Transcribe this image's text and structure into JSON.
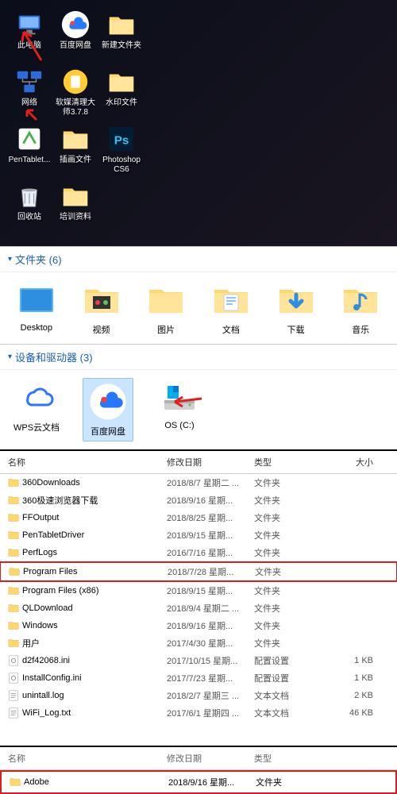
{
  "desktop_rows": [
    [
      {
        "name": "thispc",
        "label": "此电脑",
        "type": "pc"
      },
      {
        "name": "baidu",
        "label": "百度网盘",
        "type": "baidu"
      },
      {
        "name": "newfolder",
        "label": "新建文件夹",
        "type": "folder"
      }
    ],
    [
      {
        "name": "network",
        "label": "网络",
        "type": "network"
      },
      {
        "name": "ruanmei",
        "label": "软媒清理大师3.7.8",
        "type": "app1"
      },
      {
        "name": "watermark",
        "label": "水印文件",
        "type": "folder"
      }
    ],
    [
      {
        "name": "pentablet",
        "label": "PenTablet...",
        "type": "app2"
      },
      {
        "name": "illust",
        "label": "插画文件",
        "type": "folder"
      },
      {
        "name": "ps",
        "label": "Photoshop CS6",
        "type": "ps"
      }
    ],
    [
      {
        "name": "recycle",
        "label": "回收站",
        "type": "recycle"
      },
      {
        "name": "training",
        "label": "培训资料",
        "type": "folder"
      }
    ]
  ],
  "folder_section": {
    "title": "文件夹 (6)"
  },
  "folders": [
    {
      "name": "desktop",
      "label": "Desktop",
      "type": "desktop-folder"
    },
    {
      "name": "video",
      "label": "视频",
      "type": "video"
    },
    {
      "name": "pictures",
      "label": "图片",
      "type": "pictures"
    },
    {
      "name": "docs",
      "label": "文档",
      "type": "docs"
    },
    {
      "name": "download",
      "label": "下载",
      "type": "download"
    },
    {
      "name": "music",
      "label": "音乐",
      "type": "music"
    }
  ],
  "device_section": {
    "title": "设备和驱动器 (3)"
  },
  "devices": [
    {
      "name": "wps",
      "label": "WPS云文档",
      "type": "wps"
    },
    {
      "name": "baidu2",
      "label": "百度网盘",
      "type": "baidu",
      "selected": true
    },
    {
      "name": "osc",
      "label": "OS (C:)",
      "type": "drive"
    }
  ],
  "columns": {
    "c1": "名称",
    "c2": "修改日期",
    "c3": "类型",
    "c4": "大小"
  },
  "files": [
    {
      "name": "360Downloads",
      "date": "2018/8/7 星期二 ...",
      "type": "文件夹",
      "size": "",
      "icon": "folder"
    },
    {
      "name": "360极速浏览器下载",
      "date": "2018/9/16 星期...",
      "type": "文件夹",
      "size": "",
      "icon": "folder"
    },
    {
      "name": "FFOutput",
      "date": "2018/8/25 星期...",
      "type": "文件夹",
      "size": "",
      "icon": "folder"
    },
    {
      "name": "PenTabletDriver",
      "date": "2018/9/15 星期...",
      "type": "文件夹",
      "size": "",
      "icon": "folder"
    },
    {
      "name": "PerfLogs",
      "date": "2016/7/16 星期...",
      "type": "文件夹",
      "size": "",
      "icon": "folder"
    },
    {
      "name": "Program Files",
      "date": "2018/7/28 星期...",
      "type": "文件夹",
      "size": "",
      "icon": "folder",
      "hl": true
    },
    {
      "name": "Program Files (x86)",
      "date": "2018/9/15 星期...",
      "type": "文件夹",
      "size": "",
      "icon": "folder"
    },
    {
      "name": "QLDownload",
      "date": "2018/9/4 星期二 ...",
      "type": "文件夹",
      "size": "",
      "icon": "folder"
    },
    {
      "name": "Windows",
      "date": "2018/9/16 星期...",
      "type": "文件夹",
      "size": "",
      "icon": "folder"
    },
    {
      "name": "用户",
      "date": "2017/4/30 星期...",
      "type": "文件夹",
      "size": "",
      "icon": "folder"
    },
    {
      "name": "d2f42068.ini",
      "date": "2017/10/15 星期...",
      "type": "配置设置",
      "size": "1 KB",
      "icon": "ini"
    },
    {
      "name": "InstallConfig.ini",
      "date": "2017/7/23 星期...",
      "type": "配置设置",
      "size": "1 KB",
      "icon": "ini"
    },
    {
      "name": "unintall.log",
      "date": "2018/2/7 星期三 ...",
      "type": "文本文档",
      "size": "2 KB",
      "icon": "txt"
    },
    {
      "name": "WiFi_Log.txt",
      "date": "2017/6/1 星期四 ...",
      "type": "文本文档",
      "size": "46 KB",
      "icon": "txt"
    }
  ],
  "bottom_cols": {
    "c1": "名称",
    "c2": "修改日期",
    "c3": "类型"
  },
  "bottom_row": {
    "name": "Adobe",
    "date": "2018/9/16 星期...",
    "type": "文件夹"
  }
}
